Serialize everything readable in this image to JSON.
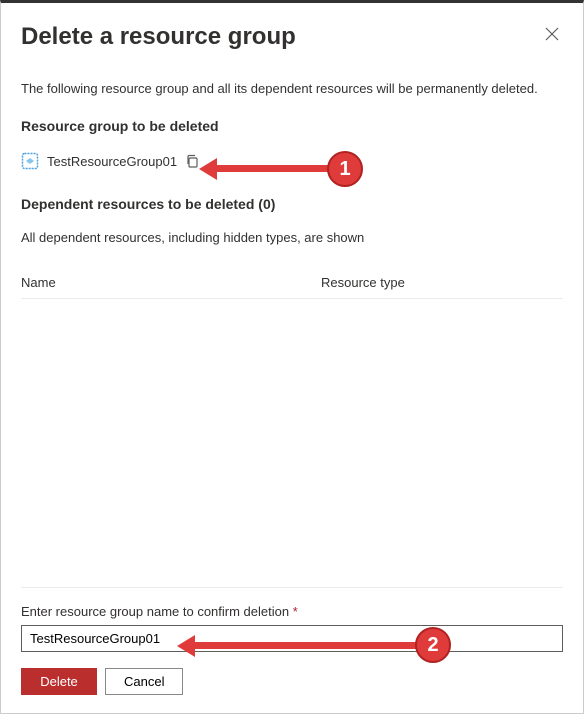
{
  "header": {
    "title": "Delete a resource group"
  },
  "warning_text": "The following resource group and all its dependent resources will be permanently deleted.",
  "section_rg_title": "Resource group to be deleted",
  "resource_group": {
    "name": "TestResourceGroup01"
  },
  "section_dep_title": "Dependent resources to be deleted (0)",
  "dep_note": "All dependent resources, including hidden types, are shown",
  "table": {
    "col_name": "Name",
    "col_type": "Resource type"
  },
  "confirm": {
    "label": "Enter resource group name to confirm deletion",
    "required_mark": "*",
    "value": "TestResourceGroup01"
  },
  "buttons": {
    "delete": "Delete",
    "cancel": "Cancel"
  },
  "annotations": {
    "badge1": "1",
    "badge2": "2"
  }
}
